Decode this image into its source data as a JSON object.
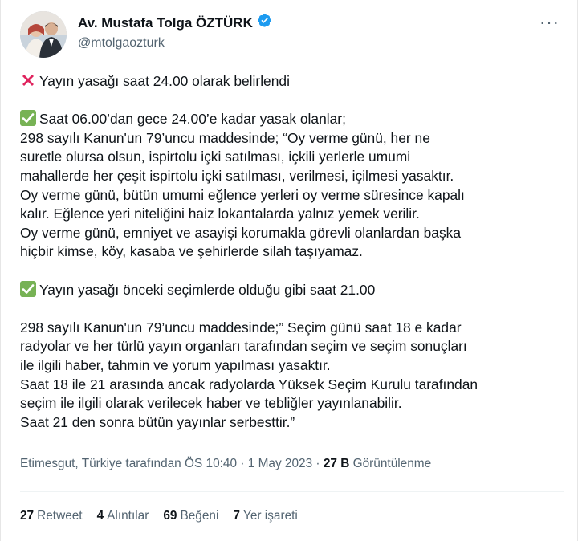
{
  "author": {
    "name": "Av. Mustafa Tolga ÖZTÜRK",
    "handle": "@mtolgaozturk",
    "verified": true
  },
  "more_icon": "more-horizontal-icon",
  "tweet": {
    "lines": [
      {
        "emoji": "cross-mark-icon",
        "text": "Yayın yasağı saat 24.00 olarak belirlendi"
      },
      {
        "blank": true
      },
      {
        "emoji": "check-mark-icon",
        "text": "Saat 06.00’dan gece 24.00’e kadar yasak olanlar;"
      },
      {
        "text": "298 sayılı Kanun'un 79’uncu maddesinde; “Oy verme günü, her ne"
      },
      {
        "text": "suretle olursa olsun, ispirtolu içki satılması, içkili yerlerle umumi"
      },
      {
        "text": "mahallerde her çeşit ispirtolu içki satılması, verilmesi, içilmesi yasaktır."
      },
      {
        "text": "Oy verme günü, bütün umumi eğlence yerleri oy verme süresince kapalı"
      },
      {
        "text": "kalır. Eğlence yeri niteliğini haiz lokantalarda yalnız yemek verilir."
      },
      {
        "text": "Oy verme günü, emniyet ve asayişi korumakla görevli olanlardan başka"
      },
      {
        "text": "hiçbir kimse, köy, kasaba ve şehirlerde silah taşıyamaz."
      },
      {
        "blank": true
      },
      {
        "emoji": "check-mark-icon",
        "text": "Yayın yasağı önceki seçimlerde olduğu gibi saat 21.00"
      },
      {
        "blank": true
      },
      {
        "text": "298 sayılı Kanun'un 79’uncu maddesinde;” Seçim günü saat 18 e kadar"
      },
      {
        "text": "radyolar ve her türlü yayın organları tarafından seçim ve seçim sonuçları"
      },
      {
        "text": "ile ilgili haber, tahmin ve yorum yapılması yasaktır."
      },
      {
        "text": "Saat 18 ile 21 arasında ancak radyolarda Yüksek Seçim Kurulu tarafından"
      },
      {
        "text": "seçim ile ilgili olarak verilecek haber ve tebliğler yayınlanabilir."
      },
      {
        "text": "Saat 21 den sonra bütün yayınlar serbesttir.”"
      }
    ]
  },
  "meta": {
    "location_time": "Etimesgut, Türkiye tarafından ÖS 10:40 · 1 May 2023 · ",
    "views_count": "27 B",
    "views_label": "Görüntülenme"
  },
  "stats": [
    {
      "count": "27",
      "label": "Retweet"
    },
    {
      "count": "4",
      "label": "Alıntılar"
    },
    {
      "count": "69",
      "label": "Beğeni"
    },
    {
      "count": "7",
      "label": "Yer işareti"
    }
  ],
  "colors": {
    "text": "#0f1419",
    "secondary": "#536471",
    "verified": "#1d9bf0",
    "cross": "#e0245e",
    "check": "#77b255"
  }
}
